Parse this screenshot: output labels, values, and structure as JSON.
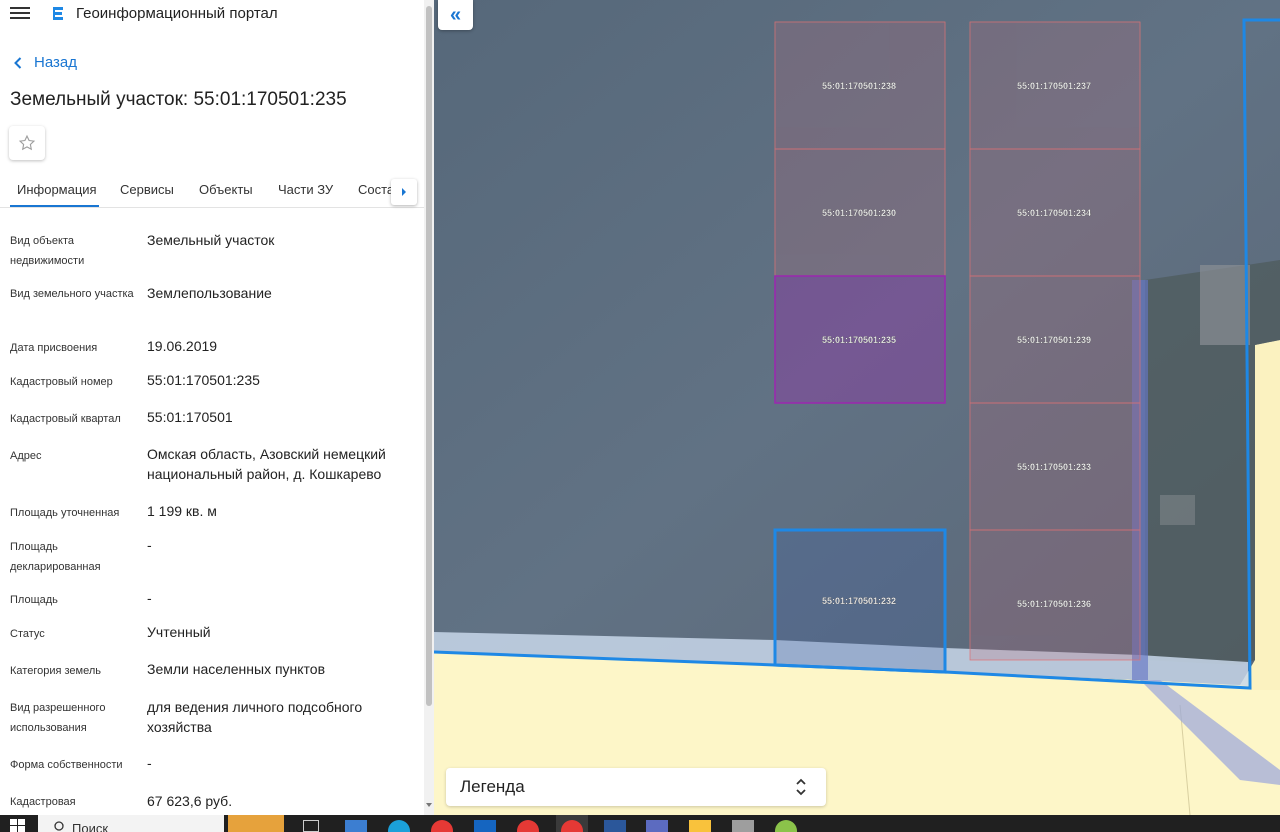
{
  "app": {
    "title": "Геоинформационный портал"
  },
  "nav": {
    "back_label": "Назад"
  },
  "page": {
    "title": "Земельный участок: 55:01:170501:235"
  },
  "tabs": [
    {
      "label": "Информация",
      "active": true
    },
    {
      "label": "Сервисы"
    },
    {
      "label": "Объекты"
    },
    {
      "label": "Части ЗУ"
    },
    {
      "label": "Соста"
    }
  ],
  "details": [
    {
      "label": "Вид объекта недвижимости",
      "value": "Земельный участок"
    },
    {
      "label": "Вид земельного участка",
      "value": "Землепользование"
    },
    {
      "label": "Дата присвоения",
      "value": "19.06.2019"
    },
    {
      "label": "Кадастровый номер",
      "value": "55:01:170501:235"
    },
    {
      "label": "Кадастровый квартал",
      "value": "55:01:170501"
    },
    {
      "label": "Адрес",
      "value": "Омская область, Азовский немецкий национальный район, д. Кошкарево"
    },
    {
      "label": "Площадь уточненная",
      "value": "1 199 кв. м"
    },
    {
      "label": "Площадь декларированная",
      "value": "-"
    },
    {
      "label": "Площадь",
      "value": "-"
    },
    {
      "label": "Статус",
      "value": "Учтенный"
    },
    {
      "label": "Категория земель",
      "value": "Земли населенных пунктов"
    },
    {
      "label": "Вид разрешенного использования",
      "value": "для ведения личного подсобного хозяйства"
    },
    {
      "label": "Форма собственности",
      "value": "-"
    },
    {
      "label": "Кадастровая",
      "value": "67 623,6 руб."
    }
  ],
  "map": {
    "parcels": [
      {
        "id": "55:01:170501:238"
      },
      {
        "id": "55:01:170501:237"
      },
      {
        "id": "55:01:170501:230"
      },
      {
        "id": "55:01:170501:234"
      },
      {
        "id": "55:01:170501:235",
        "selected": true
      },
      {
        "id": "55:01:170501:239"
      },
      {
        "id": "55:01:170501:233"
      },
      {
        "id": "55:01:170501:232",
        "highlighted": true
      },
      {
        "id": "55:01:170501:236"
      }
    ],
    "legend_label": "Легенда",
    "colors": {
      "selected_parcel": "#9c27b0",
      "highlight_outline": "#1e88e5",
      "parcel_outline": "#e57373",
      "imagery": "#5a6b7d",
      "field_yellow": "#fdf6c8"
    }
  },
  "taskbar": {
    "search_placeholder": "Поиск"
  }
}
